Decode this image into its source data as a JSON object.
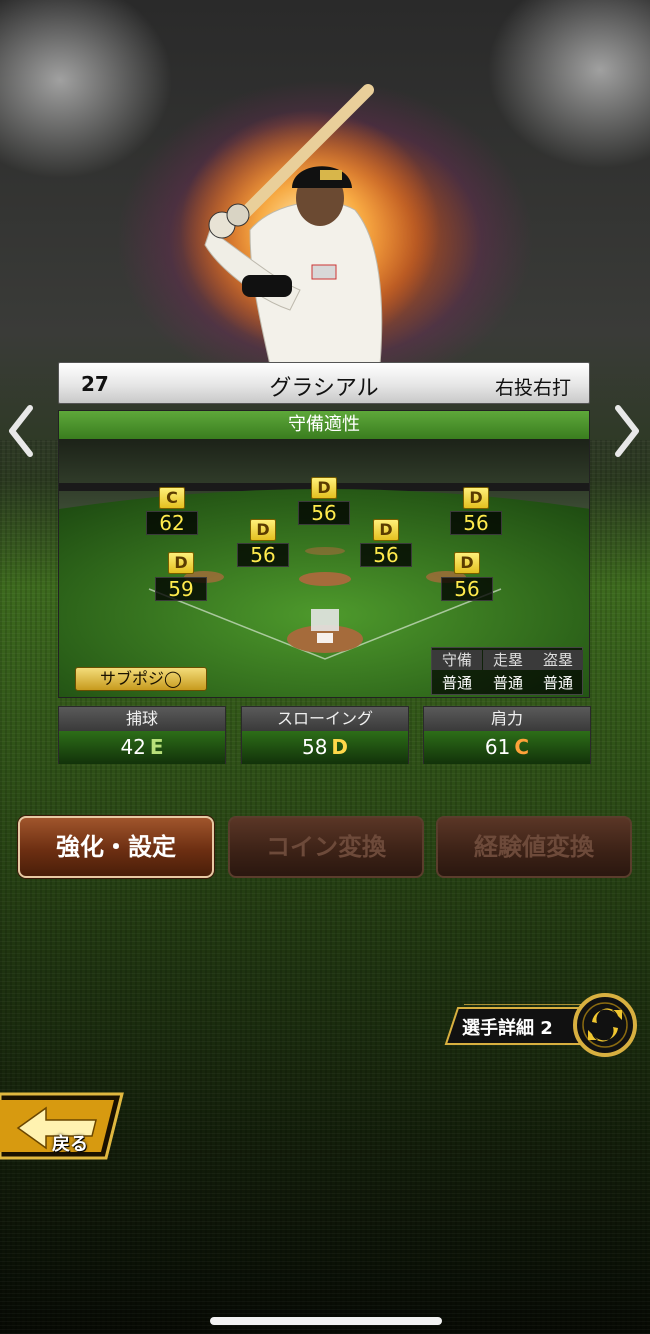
{
  "player": {
    "number": "27",
    "name": "グラシアル",
    "handedness": "右投右打"
  },
  "defense": {
    "title": "守備適性",
    "positions": [
      {
        "key": "lf",
        "grade": "C",
        "value": "62"
      },
      {
        "key": "cf",
        "grade": "D",
        "value": "56"
      },
      {
        "key": "rf",
        "grade": "D",
        "value": "56"
      },
      {
        "key": "ss",
        "grade": "D",
        "value": "56"
      },
      {
        "key": "2b",
        "grade": "D",
        "value": "56"
      },
      {
        "key": "3b",
        "grade": "D",
        "value": "59"
      },
      {
        "key": "1b",
        "grade": "D",
        "value": "56"
      }
    ],
    "sub_position_label": "サブポジ◯",
    "mini_stats": {
      "headers": [
        "守備",
        "走塁",
        "盗塁"
      ],
      "values": [
        "普通",
        "普通",
        "普通"
      ]
    }
  },
  "stats": [
    {
      "label": "捕球",
      "value": "42",
      "grade": "E",
      "grade_color": "#b8e07a"
    },
    {
      "label": "スローイング",
      "value": "58",
      "grade": "D",
      "grade_color": "#ffd84a"
    },
    {
      "label": "肩力",
      "value": "61",
      "grade": "C",
      "grade_color": "#ffa23a"
    }
  ],
  "actions": {
    "enhance": "強化・設定",
    "coin": "コイン変換",
    "exp": "経験値変換"
  },
  "detail2_label": "選手詳細 2",
  "back_label": "戻る",
  "icons": {
    "left": "chevron-left-icon",
    "right": "chevron-right-icon",
    "swap": "swap-arrows-icon",
    "back": "back-arrow-icon"
  }
}
